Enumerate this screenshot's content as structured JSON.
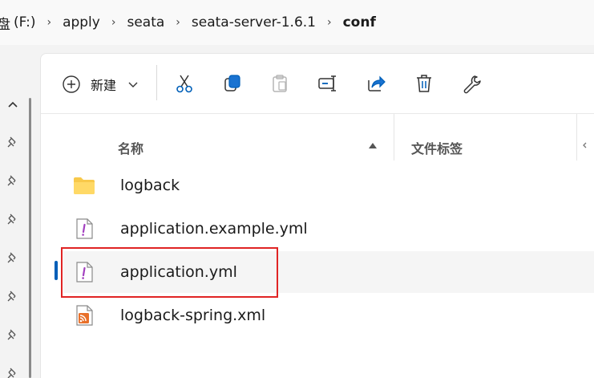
{
  "breadcrumb": {
    "partial_char": "盘",
    "items": [
      "(F:)",
      "apply",
      "seata",
      "seata-server-1.6.1",
      "conf"
    ]
  },
  "toolbar": {
    "new_label": "新建",
    "icons": [
      "cut-icon",
      "copy-icon",
      "paste-icon",
      "rename-icon",
      "share-icon",
      "delete-icon",
      "properties-icon"
    ]
  },
  "columns": {
    "name": "名称",
    "tags": "文件标签"
  },
  "files": [
    {
      "name": "logback",
      "icon": "folder-icon"
    },
    {
      "name": "application.example.yml",
      "icon": "yml-file-icon"
    },
    {
      "name": "application.yml",
      "icon": "yml-file-icon",
      "selected": true
    },
    {
      "name": "logback-spring.xml",
      "icon": "xml-file-icon"
    }
  ],
  "colors": {
    "accent": "#005fb8",
    "highlight": "#e02424",
    "folder": "#f8c94a"
  }
}
